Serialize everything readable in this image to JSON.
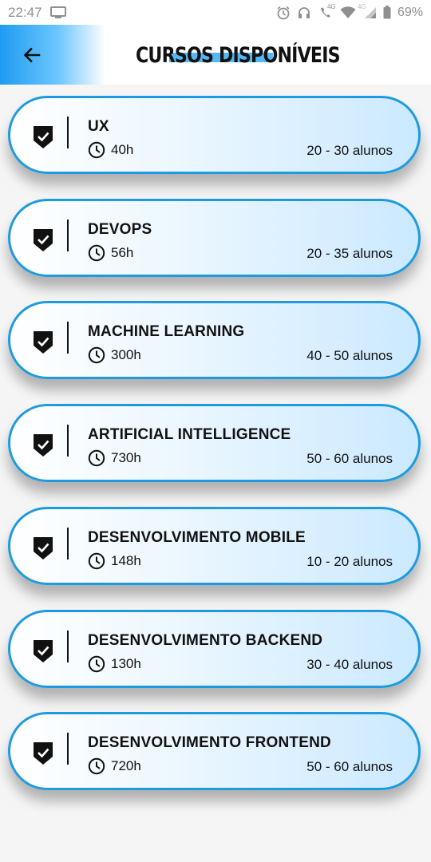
{
  "status_bar": {
    "time": "22:47",
    "network_label": "4G",
    "network_label_2": "4G",
    "battery": "69%",
    "icons": [
      "screen-icon",
      "alarm-icon",
      "headset-icon",
      "wifi-call-icon",
      "wifi-icon",
      "signal-icon",
      "battery-icon"
    ]
  },
  "app_bar": {
    "title": "CURSOS DISPONÍVEIS",
    "back_icon": "arrow-left-icon",
    "accent_color": "#1e9bf0"
  },
  "courses": [
    {
      "name": "UX",
      "hours": "40h",
      "students": "20 - 30 alunos"
    },
    {
      "name": "DEVOPS",
      "hours": "56h",
      "students": "20 - 35 alunos"
    },
    {
      "name": "MACHINE LEARNING",
      "hours": "300h",
      "students": "40 - 50 alunos"
    },
    {
      "name": "ARTIFICIAL INTELLIGENCE",
      "hours": "730h",
      "students": "50 - 60 alunos"
    },
    {
      "name": "DESENVOLVIMENTO MOBILE",
      "hours": "148h",
      "students": "10 - 20 alunos"
    },
    {
      "name": "DESENVOLVIMENTO BACKEND",
      "hours": "130h",
      "students": "30 - 40 alunos"
    },
    {
      "name": "DESENVOLVIMENTO FRONTEND",
      "hours": "720h",
      "students": "50 - 60 alunos"
    }
  ],
  "card_style": {
    "border_color": "#1e9be0",
    "check_icon": "shield-check-icon",
    "clock_icon": "clock-icon"
  }
}
